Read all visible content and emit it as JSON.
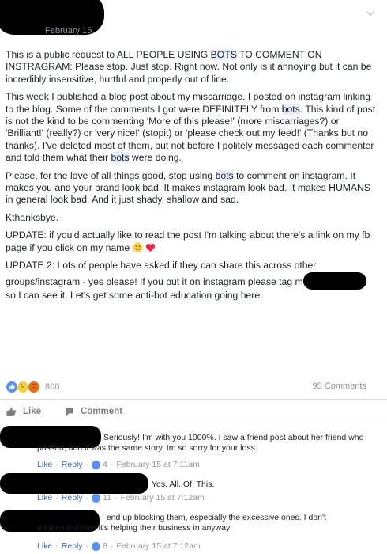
{
  "post": {
    "date": "February 15",
    "paragraphs": [
      [
        "This is a public request to ALL PEOPLE USING ",
        {
          "hl": "BOTS"
        },
        " TO COMMENT ON INSTRAGRAM: Please stop. Just stop. Right now. Not only is it annoying but it can be incredibly insensitive, hurtful and properly out of line."
      ],
      [
        "This week I published a blog post about my miscarriage. I posted on instagram linking to the blog. Some of the comments I got were DEFINITELY from ",
        {
          "hl": "bots"
        },
        ". This kind of post is not the kind to be commenting 'More of this please!' (more miscarriages?) or 'Brilliant!' (really?) or 'very nice!' (stopit) or 'please check out my feed!' (Thanks but no thanks). I've deleted most of them, but not before I politely messaged each commenter and told them what their ",
        {
          "hl": "bots"
        },
        " were doing."
      ],
      [
        "Please, for the love of all things good, stop using ",
        {
          "hl": "bots"
        },
        " to comment on instagram. It makes you and your brand look bad. It makes instagram look bad. It makes HUMANS in general look bad. And it just shady, shallow and sad."
      ],
      [
        "Kthanksbye."
      ],
      [
        "UPDATE: if you'd actually like to read the post I'm talking about there's a link on my fb page if you click on my name ",
        {
          "emoji": "smile"
        },
        " ",
        {
          "emoji": "heart"
        }
      ],
      [
        "UPDATE 2: Lots of people have asked if they can share this across other groups/instagram - yes please! If you put it on instagram please tag me ",
        {
          "redact": 80
        },
        " so I can see it. Let's get some anti-bot education going here."
      ]
    ]
  },
  "stats": {
    "reaction_count": "800",
    "comments_count": "95 Comments"
  },
  "actions": {
    "like_label": "Like",
    "comment_label": "Comment"
  },
  "comments": [
    {
      "text": "Seriously! I'm with you 1000%. I saw a friend post about her friend who passed, and it was the same story. Im so sorry for your loss.",
      "like_label": "Like",
      "reply_label": "Reply",
      "like_count": "4",
      "time": "February 15 at 7:11am"
    },
    {
      "text": "Yes. All. Of. This.",
      "like_label": "Like",
      "reply_label": "Reply",
      "like_count": "11",
      "time": "February 15 at 7:12am"
    },
    {
      "text": "I end up blocking them, especially the excessive ones. I don't understand how it's helping their business in anyway",
      "like_label": "Like",
      "reply_label": "Reply",
      "like_count": "8",
      "time": "February 15 at 7:12am"
    }
  ],
  "colors": {
    "link": "#4267b2",
    "meta": "#90949c",
    "highlight": "#e8eefa",
    "heart": "#f0284a",
    "like_blue": "#5890ff"
  }
}
